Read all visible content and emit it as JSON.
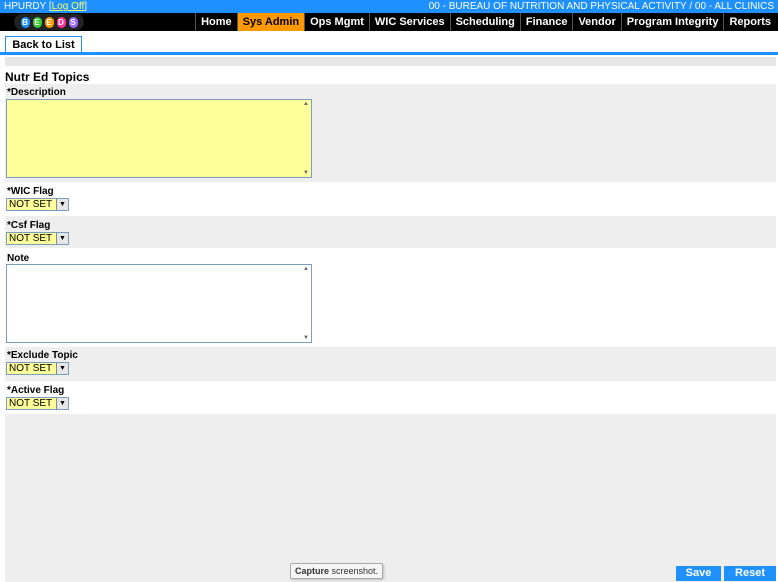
{
  "topbar": {
    "user": "HPURDY",
    "logoff": "Log Off",
    "clinic": "00 - BUREAU OF NUTRITION AND PHYSICAL ACTIVITY / 00 - ALL CLINICS"
  },
  "logo": {
    "letters": [
      "B",
      "E",
      "E",
      "D",
      "S"
    ],
    "colors": [
      "#1e90ff",
      "#33cc33",
      "#ff9900",
      "#ff3399",
      "#9966ff"
    ]
  },
  "menu": [
    "Home",
    "Sys Admin",
    "Ops Mgmt",
    "WIC Services",
    "Scheduling",
    "Finance",
    "Vendor",
    "Program Integrity",
    "Reports"
  ],
  "active_menu": "Sys Admin",
  "back_label": "Back to List",
  "section_title": "Nutr Ed Topics",
  "fields": {
    "description_label": "*Description",
    "description_value": "",
    "wic_flag_label": "*WIC Flag",
    "wic_flag_value": "NOT SET",
    "csf_flag_label": "*Csf Flag",
    "csf_flag_value": "NOT SET",
    "note_label": "Note",
    "note_value": "",
    "exclude_topic_label": "*Exclude Topic",
    "exclude_topic_value": "NOT SET",
    "active_flag_label": "*Active Flag",
    "active_flag_value": "NOT SET"
  },
  "tooltip": {
    "bold": "Capture",
    "rest": " screenshot."
  },
  "actions": {
    "save": "Save",
    "reset": "Reset"
  },
  "colors": {
    "accent": "#1e90ff",
    "active_tab": "#ff9900",
    "required_field": "#ffff99"
  }
}
